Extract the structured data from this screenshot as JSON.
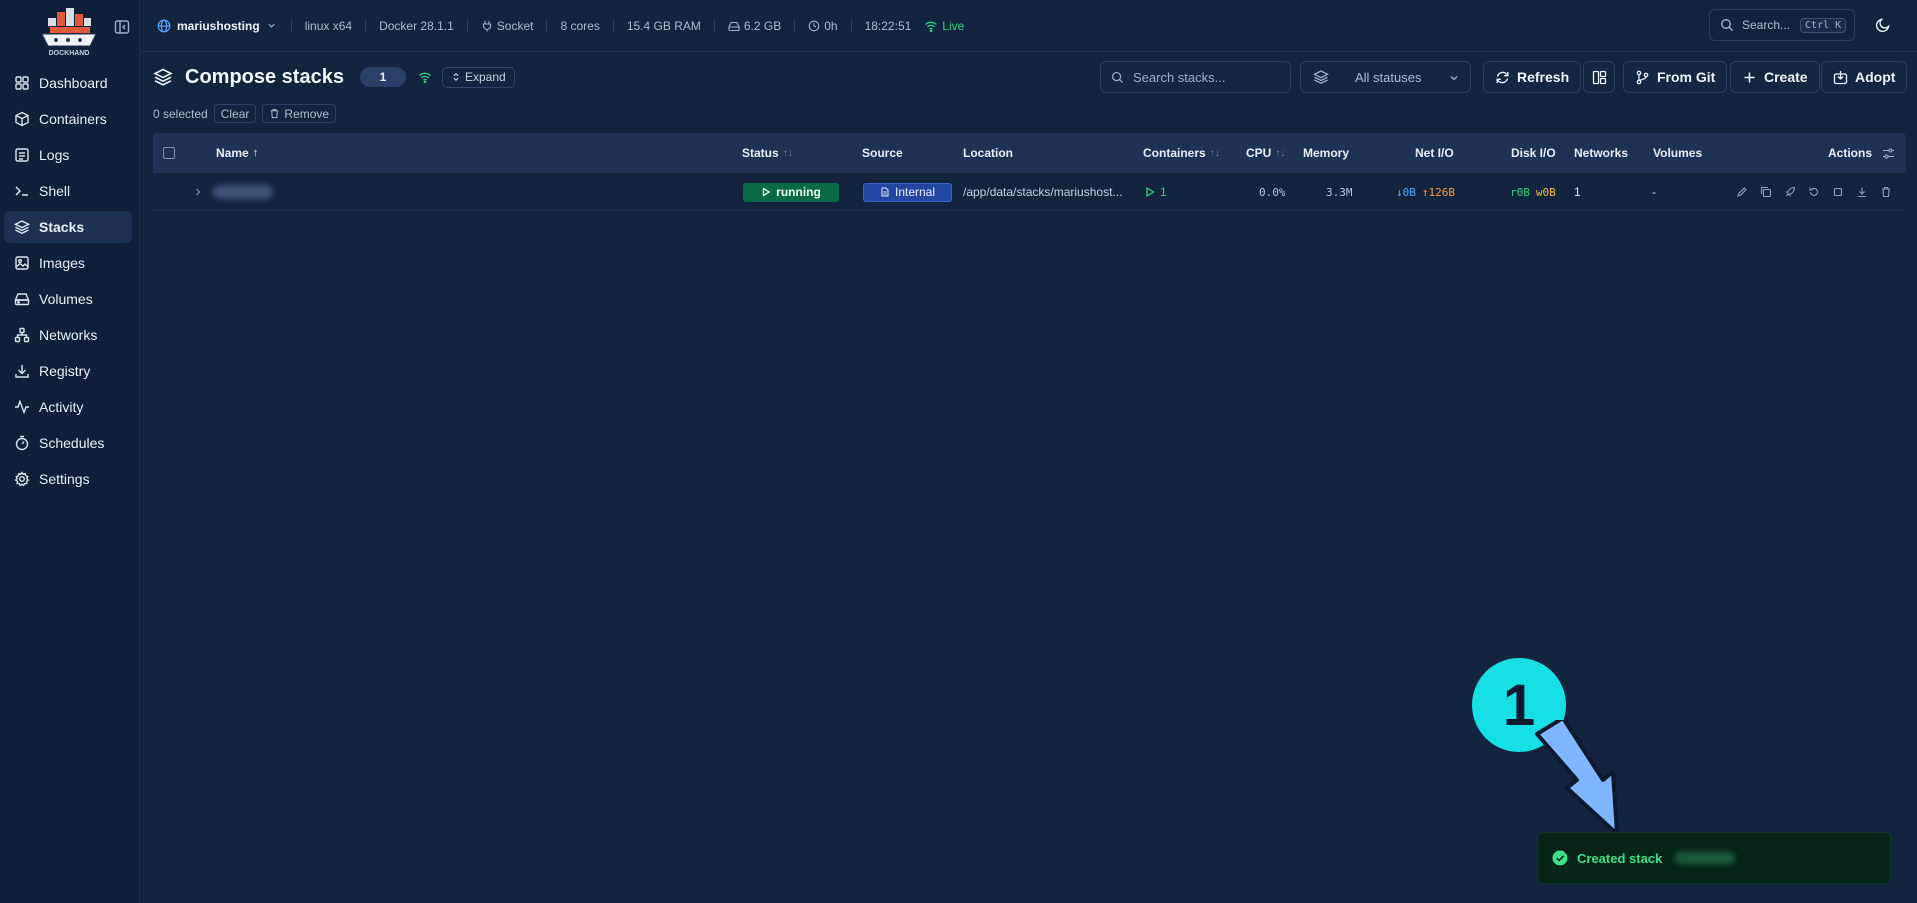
{
  "app": {
    "logo_text": "DOCKHAND"
  },
  "sidebar": {
    "items": [
      {
        "label": "Dashboard",
        "icon": "dashboard-icon"
      },
      {
        "label": "Containers",
        "icon": "box-icon"
      },
      {
        "label": "Logs",
        "icon": "logs-icon"
      },
      {
        "label": "Shell",
        "icon": "terminal-icon"
      },
      {
        "label": "Stacks",
        "icon": "layers-icon",
        "active": true
      },
      {
        "label": "Images",
        "icon": "image-icon"
      },
      {
        "label": "Volumes",
        "icon": "hard-drive-icon"
      },
      {
        "label": "Networks",
        "icon": "network-icon"
      },
      {
        "label": "Registry",
        "icon": "download-icon"
      },
      {
        "label": "Activity",
        "icon": "activity-icon"
      },
      {
        "label": "Schedules",
        "icon": "timer-icon"
      },
      {
        "label": "Settings",
        "icon": "gear-icon"
      }
    ]
  },
  "topbar": {
    "host": "mariushosting",
    "os": "linux x64",
    "docker": "Docker 28.1.1",
    "connection": "Socket",
    "cores": "8 cores",
    "ram": "15.4 GB RAM",
    "disk": "6.2 GB",
    "uptime": "0h",
    "time": "18:22:51",
    "live": "Live",
    "search_placeholder": "Search...",
    "search_shortcut": "Ctrl K"
  },
  "header": {
    "title": "Compose stacks",
    "count": "1",
    "expand_label": "Expand",
    "selected_text": "0 selected",
    "clear_label": "Clear",
    "remove_label": "Remove",
    "search_placeholder": "Search stacks...",
    "status_filter": "All statuses",
    "buttons": {
      "refresh": "Refresh",
      "from_git": "From Git",
      "create": "Create",
      "adopt": "Adopt"
    }
  },
  "table": {
    "columns": {
      "name": "Name",
      "status": "Status",
      "source": "Source",
      "location": "Location",
      "containers": "Containers",
      "cpu": "CPU",
      "memory": "Memory",
      "net_io": "Net I/O",
      "disk_io": "Disk I/O",
      "networks": "Networks",
      "volumes": "Volumes",
      "actions": "Actions"
    },
    "rows": [
      {
        "status": "running",
        "source": "Internal",
        "location": "/app/data/stacks/mariushost...",
        "containers": "1",
        "cpu": "0.0%",
        "memory": "3.3M",
        "net_in": "↓0B",
        "net_out": "↑126B",
        "disk_read": "r0B",
        "disk_write": "w0B",
        "networks": "1",
        "volumes": "-"
      }
    ]
  },
  "annotation": {
    "number": "1"
  },
  "toast": {
    "message": "Created stack"
  },
  "colors": {
    "accent_green": "#2fd47a",
    "callout_cyan": "#16e0e6",
    "arrow_blue": "#7fb6ff"
  }
}
